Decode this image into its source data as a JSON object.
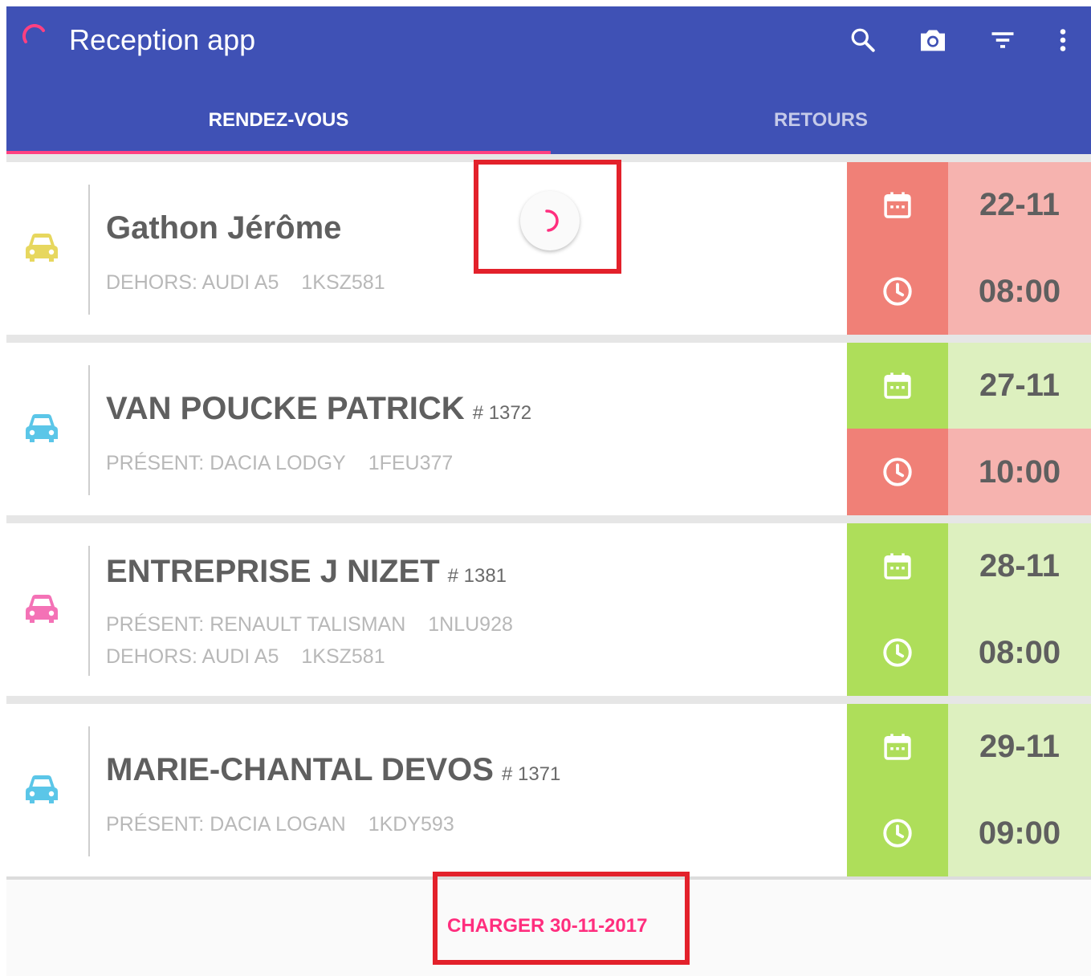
{
  "app": {
    "title": "Reception app"
  },
  "toolbar": {
    "icons": [
      "search-icon",
      "camera-icon",
      "filter-icon",
      "more-vert-icon"
    ]
  },
  "tabs": [
    {
      "label": "RENDEZ-VOUS",
      "selected": true
    },
    {
      "label": "RETOURS",
      "selected": false
    }
  ],
  "colors": {
    "appbar": "#3f51b5",
    "accent": "#ff4081",
    "late_icon_bg": "#f08077",
    "late_value_bg": "#f6b3af",
    "ok_icon_bg": "#aede5a",
    "ok_value_bg": "#ddf0bf",
    "car_yellow": "#e7d75e",
    "car_blue": "#5bc6e8",
    "car_pink": "#f472b6",
    "highlight": "#e3212b"
  },
  "appointments": [
    {
      "name": "Gathon Jérôme",
      "number": "",
      "car_color": "#e7d75e",
      "vehicles": [
        {
          "status": "DEHORS: AUDI A5",
          "plate": "1KSZ581"
        }
      ],
      "date": "22-11",
      "time": "08:00",
      "date_status": "late",
      "time_status": "late"
    },
    {
      "name": "VAN POUCKE PATRICK",
      "number": "# 1372",
      "car_color": "#5bc6e8",
      "vehicles": [
        {
          "status": "PRÉSENT: DACIA LODGY",
          "plate": "1FEU377"
        }
      ],
      "date": "27-11",
      "time": "10:00",
      "date_status": "ok",
      "time_status": "late"
    },
    {
      "name": "ENTREPRISE J NIZET",
      "number": "# 1381",
      "car_color": "#f472b6",
      "vehicles": [
        {
          "status": "PRÉSENT: RENAULT TALISMAN",
          "plate": "1NLU928"
        },
        {
          "status": "DEHORS: AUDI A5",
          "plate": "1KSZ581"
        }
      ],
      "date": "28-11",
      "time": "08:00",
      "date_status": "ok",
      "time_status": "ok"
    },
    {
      "name": "MARIE-CHANTAL DEVOS",
      "number": "# 1371",
      "car_color": "#5bc6e8",
      "vehicles": [
        {
          "status": "PRÉSENT: DACIA LOGAN",
          "plate": "1KDY593"
        }
      ],
      "date": "29-11",
      "time": "09:00",
      "date_status": "ok",
      "time_status": "ok"
    }
  ],
  "footer": {
    "load_more_label": "CHARGER 30-11-2017"
  }
}
